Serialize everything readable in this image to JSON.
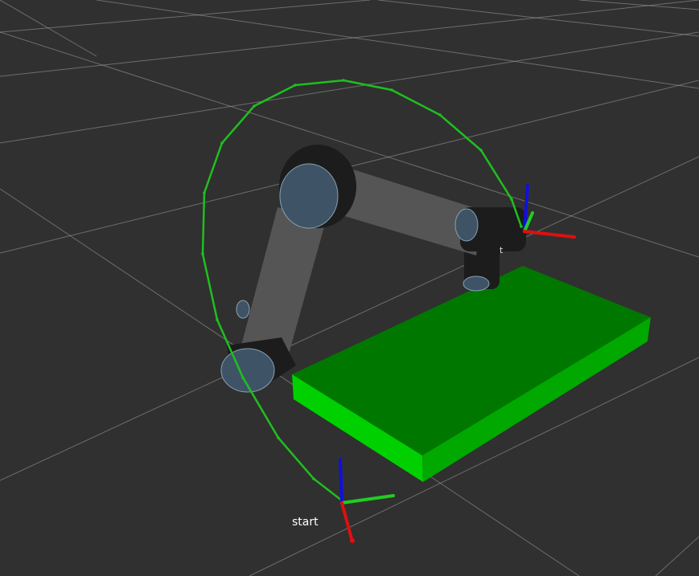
{
  "view": {
    "background_color": "#303030",
    "grid_color": "#a0a0a0"
  },
  "labels": {
    "start": "start",
    "tool_frame": "t"
  },
  "colors": {
    "trajectory": "#1fbf1f",
    "table_top": "#007800",
    "table_front": "#00d000",
    "table_side": "#00a800",
    "robot_link": "#555555",
    "robot_joint": "#1c1c1c",
    "joint_cap": "#3e5466",
    "axis_x": "#dd1010",
    "axis_y": "#22cc22",
    "axis_z": "#1010dd"
  },
  "icons": {
    "start_frame": "xyz-axes-icon",
    "goal_frame": "xyz-axes-icon"
  }
}
